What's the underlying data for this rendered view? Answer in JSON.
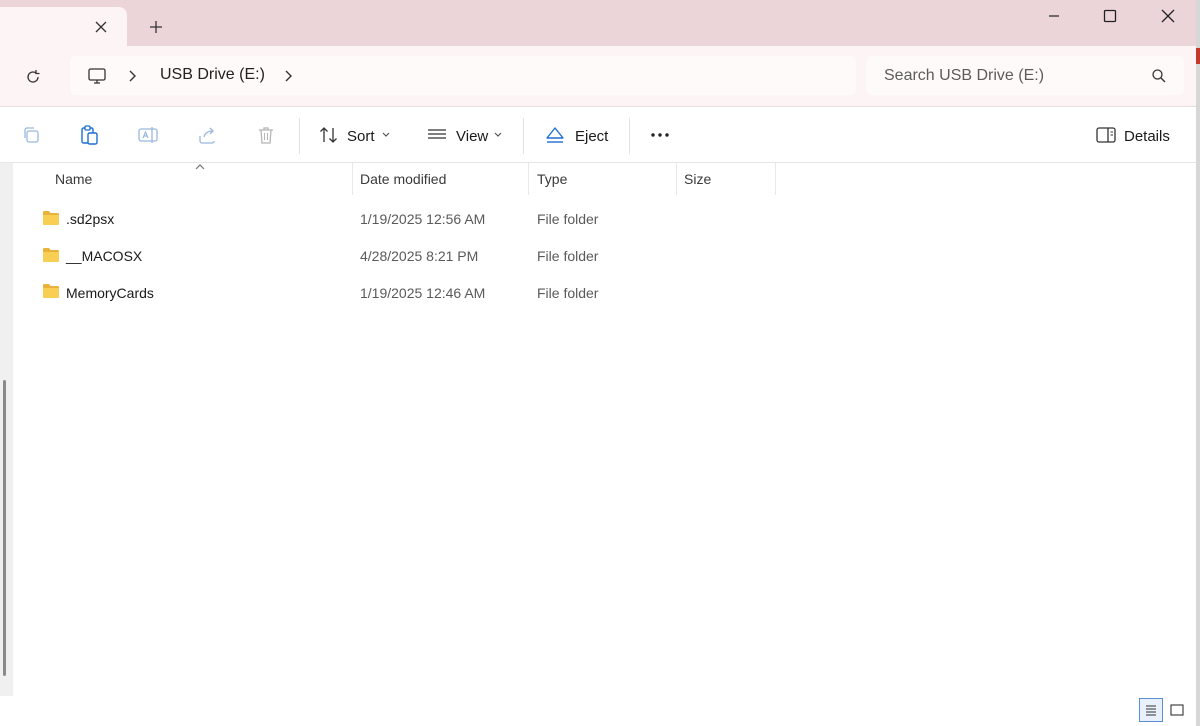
{
  "window": {
    "tab_close_icon": "close-icon",
    "new_tab_icon": "plus-icon"
  },
  "address": {
    "crumb": "USB Drive (E:)"
  },
  "search": {
    "placeholder": "Search USB Drive (E:)"
  },
  "toolbar": {
    "sort_label": "Sort",
    "view_label": "View",
    "eject_label": "Eject",
    "details_label": "Details"
  },
  "columns": {
    "name": "Name",
    "date_modified": "Date modified",
    "type": "Type",
    "size": "Size"
  },
  "files": [
    {
      "name": ".sd2psx",
      "date": "1/19/2025 12:56 AM",
      "type": "File folder",
      "size": ""
    },
    {
      "name": "__MACOSX",
      "date": "4/28/2025 8:21 PM",
      "type": "File folder",
      "size": ""
    },
    {
      "name": "MemoryCards",
      "date": "1/19/2025 12:46 AM",
      "type": "File folder",
      "size": ""
    }
  ],
  "colors": {
    "titlebar": "#ecd5d8",
    "folder": "#f4c542",
    "accent": "#1f6fd1"
  }
}
